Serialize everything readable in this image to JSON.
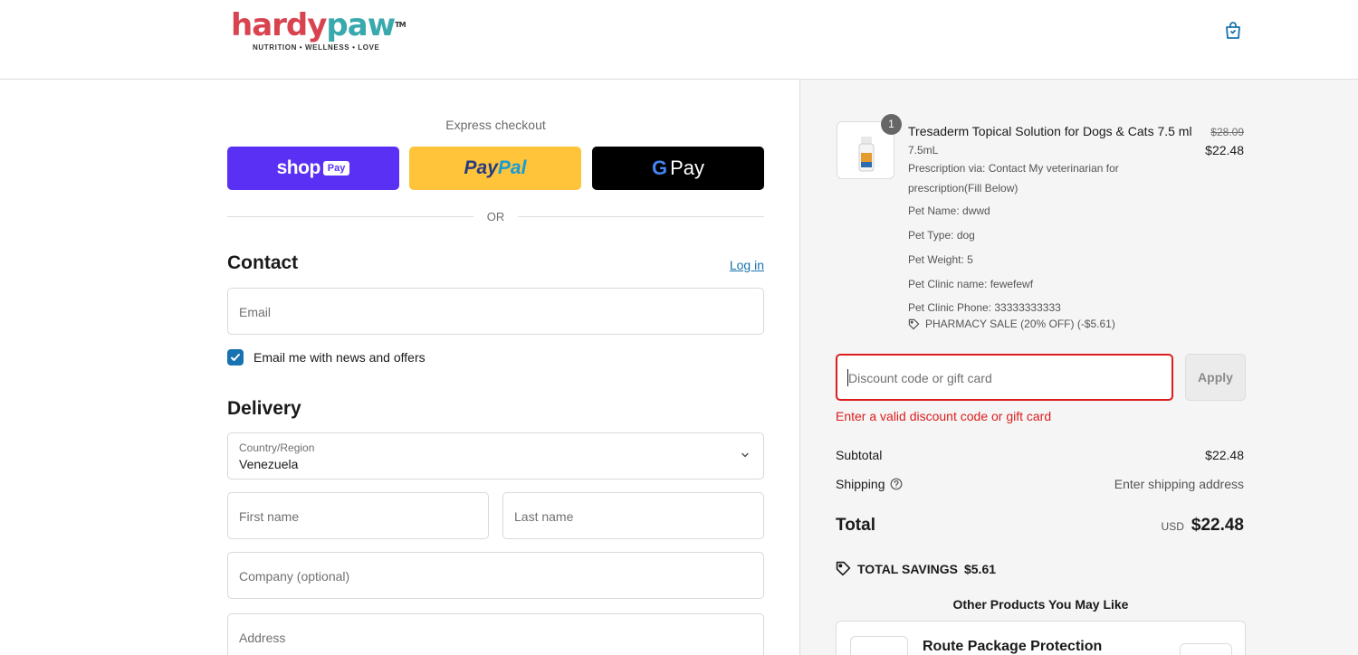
{
  "brand": {
    "name_part1": "hardy",
    "name_part2": "paw",
    "tm": "TM",
    "tagline": "NUTRITION  •  WELLNESS  •  LOVE"
  },
  "express": {
    "title": "Express checkout",
    "shop_pay_word": "shop",
    "shop_pay_badge": "Pay",
    "paypal_part1": "Pay",
    "paypal_part2": "Pal",
    "gpay_g": "G",
    "gpay_word": "Pay",
    "or": "OR"
  },
  "contact": {
    "heading": "Contact",
    "login": "Log in",
    "email_placeholder": "Email",
    "news_label": "Email me with news and offers",
    "news_checked": true
  },
  "delivery": {
    "heading": "Delivery",
    "country_label": "Country/Region",
    "country_value": "Venezuela",
    "first_name": "First name",
    "last_name": "Last name",
    "company": "Company (optional)",
    "address": "Address"
  },
  "order": {
    "quantity": "1",
    "product_name": "Tresaderm Topical Solution for Dogs & Cats 7.5 ml",
    "variant": "7.5mL",
    "prescription_line1": "Prescription via: Contact My veterinarian for",
    "prescription_line2": "prescription(Fill Below)",
    "pet_name": "Pet Name: dwwd",
    "pet_type": "Pet Type: dog",
    "pet_weight": "Pet Weight: 5",
    "clinic_name": "Pet Clinic name: fewefewf",
    "clinic_phone": "Pet Clinic Phone: 33333333333",
    "discount_line": "PHARMACY SALE (20% OFF) (-$5.61)",
    "price_original": "$28.09",
    "price_current": "$22.48"
  },
  "discount": {
    "placeholder": "Discount code or gift card",
    "apply": "Apply",
    "error": "Enter a valid discount code or gift card"
  },
  "totals": {
    "subtotal_label": "Subtotal",
    "subtotal_value": "$22.48",
    "shipping_label": "Shipping",
    "shipping_value": "Enter shipping address",
    "total_label": "Total",
    "currency": "USD",
    "total_value": "$22.48",
    "savings_label": "TOTAL SAVINGS",
    "savings_value": "$5.61"
  },
  "recommendations": {
    "title": "Other Products You May Like",
    "item_name": "Route Package Protection"
  },
  "colors": {
    "shop_pay": "#5a31f4",
    "paypal": "#ffc439",
    "gpay": "#000000",
    "link": "#1773b0",
    "error": "#dd1d1d"
  }
}
